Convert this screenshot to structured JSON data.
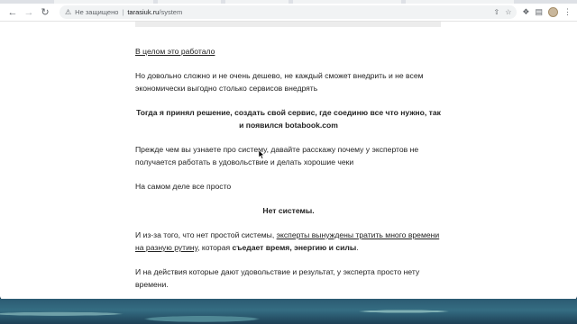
{
  "browser": {
    "security_label": "Не защищено",
    "url_host": "tarasiuk.ru",
    "url_path": "/system"
  },
  "article": {
    "p1": "В целом это работало",
    "p2": "Но довольно сложно и не очень дешево, не каждый сможет внедрить и не всем экономически выгодно столько сервисов внедрять",
    "p3": "Тогда я принял решение, создать свой сервис, где соединю все что нужно, так и появился botabook.com",
    "p4": "Прежде чем вы узнаете про систему, давайте расскажу почему у экспертов не получается работать в удовольствие и делать хорошие чеки",
    "p5": "На самом деле все просто",
    "p6": "Нет системы.",
    "p7_a": "И из-за того, что нет простой системы, ",
    "p7_link": "эксперты вынуждены тратить много времени на разную рутину",
    "p7_b": ", которая ",
    "p7_bold": "съедает время, энергию и силы",
    "p7_c": ".",
    "p8": "И на действия которые дают удовольствие и результат, у эксперта просто нету времени."
  }
}
